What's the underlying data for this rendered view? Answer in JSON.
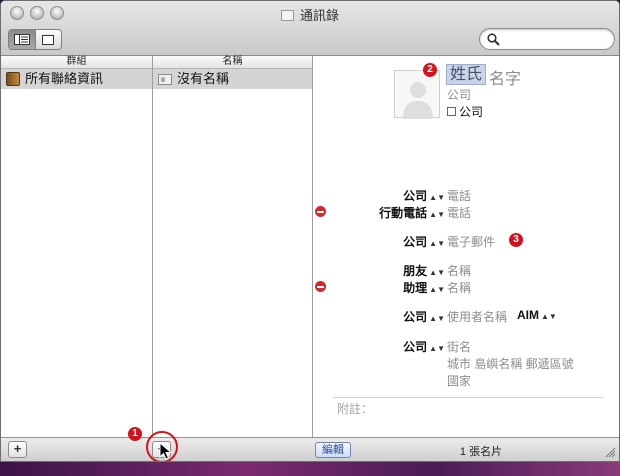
{
  "window": {
    "title": "通訊錄"
  },
  "columns": {
    "groups": "群組",
    "names": "名稱"
  },
  "groups": [
    {
      "label": "所有聯絡資訊"
    }
  ],
  "names": [
    {
      "label": "沒有名稱"
    }
  ],
  "card": {
    "last_name_placeholder": "姓氏",
    "first_name_placeholder": "名字",
    "company_placeholder": "公司",
    "company_checkbox_label": "公司",
    "phone": [
      {
        "label": "公司",
        "value": "電話"
      },
      {
        "label": "行動電話",
        "value": "電話"
      }
    ],
    "email": {
      "label": "公司",
      "value": "電子郵件"
    },
    "related": [
      {
        "label": "朋友",
        "value": "名稱"
      },
      {
        "label": "助理",
        "value": "名稱"
      }
    ],
    "im": {
      "label": "公司",
      "value": "使用者名稱",
      "service": "AIM"
    },
    "address": {
      "label": "公司",
      "street": "街名",
      "line2": "城市 島嶼名稱 郵遞區號",
      "country": "國家"
    },
    "note_label": "附註："
  },
  "badges": [
    "1",
    "2",
    "3"
  ],
  "footer": {
    "edit_label": "編輯",
    "count": "1 張名片",
    "add_label": "+"
  },
  "colors": {
    "badge": "#d8121d",
    "delete": "#d0292e",
    "selection": "#d4d4d4"
  }
}
